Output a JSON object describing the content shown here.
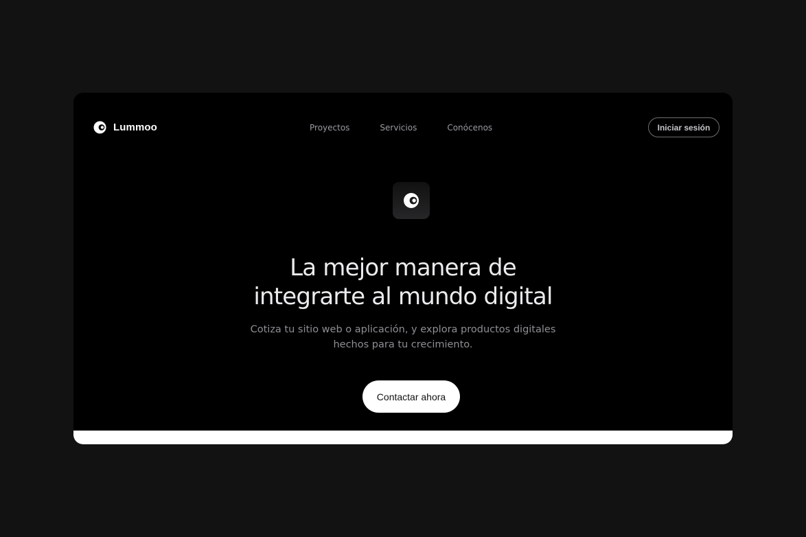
{
  "brand": {
    "name": "Lummoo",
    "icon": "crescent-logo-icon"
  },
  "nav": {
    "links": [
      "Proyectos",
      "Servicios",
      "Conócenos"
    ],
    "login_label": "Iniciar sesión"
  },
  "hero": {
    "icon": "crescent-logo-icon",
    "title_lines": [
      "La mejor manera de",
      "integrarte al mundo digital"
    ],
    "subtitle_lines": [
      "Cotiza tu sitio web o aplicación, y explora productos digitales",
      "hechos para tu crecimiento."
    ],
    "cta_label": "Contactar ahora"
  },
  "colors": {
    "page_background": "#121212",
    "frame_background": "#000000",
    "accent": "#ffffff"
  }
}
